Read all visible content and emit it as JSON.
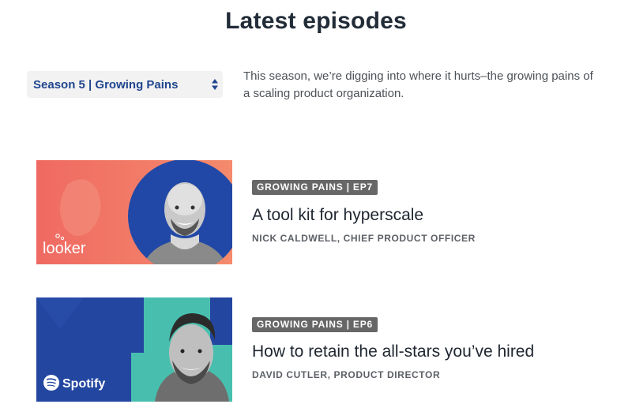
{
  "page": {
    "title": "Latest episodes"
  },
  "season_selector": {
    "selected": "Season 5 | Growing Pains",
    "description": "This season, we’re digging into where it hurts–the growing pains of a scaling product organization."
  },
  "episodes": [
    {
      "tag": "GROWING PAINS | EP7",
      "title": "A tool kit for hyperscale",
      "guest": "NICK CALDWELL, CHIEF PRODUCT OFFICER",
      "company_logo": "looker",
      "thumbnail_colors": {
        "background": "#f07265",
        "circle": "#2148a6"
      }
    },
    {
      "tag": "GROWING PAINS | EP6",
      "title": "How to retain the all-stars you’ve hired",
      "guest": "DAVID CUTLER, PRODUCT DIRECTOR",
      "company_logo": "Spotify",
      "thumbnail_colors": {
        "background": "#2346a0",
        "accent": "#48bfae"
      }
    }
  ],
  "colors": {
    "accent_blue": "#20468f",
    "tag_gray": "#676767"
  }
}
